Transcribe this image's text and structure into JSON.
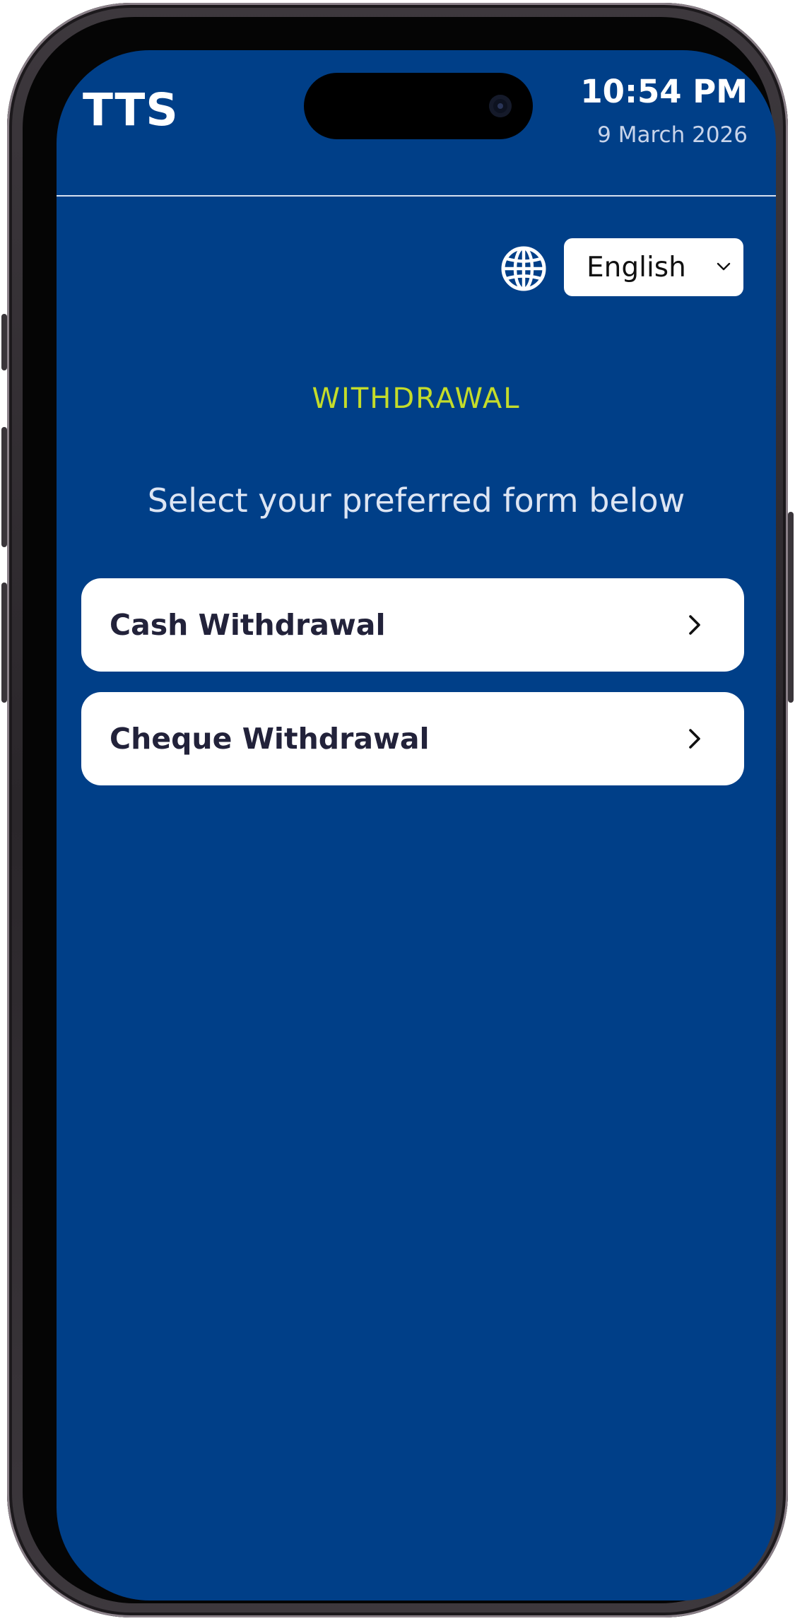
{
  "header": {
    "brand": "TTS",
    "time": "10:54 PM",
    "date": "9 March 2026"
  },
  "language": {
    "icon": "globe-icon",
    "selected": "English",
    "options": [
      "English"
    ]
  },
  "page": {
    "section_title": "WITHDRAWAL",
    "subtitle": "Select your preferred form below"
  },
  "options": [
    {
      "label": "Cash Withdrawal",
      "icon": "chevron-right-icon"
    },
    {
      "label": "Cheque Withdrawal",
      "icon": "chevron-right-icon"
    }
  ],
  "colors": {
    "background": "#003f88",
    "accent": "#c4dc2a",
    "card": "#ffffff",
    "card_text": "#22223a"
  }
}
